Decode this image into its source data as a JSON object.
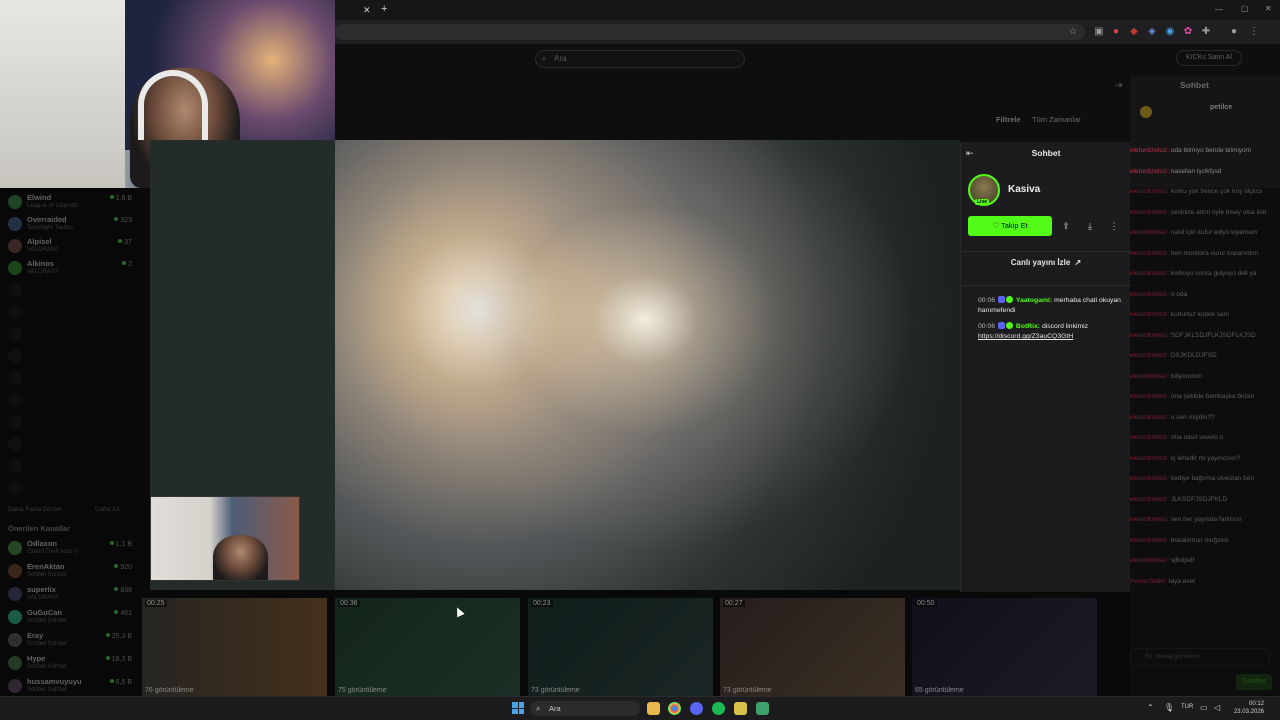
{
  "site": {
    "search_placeholder": "Ara",
    "filter_label": "Filtrele",
    "filter_value": "Tüm Zamanlar",
    "login_button": "KICKs Satın Al"
  },
  "sidebar": {
    "channels": [
      {
        "name": "Elwind",
        "game": "League of Legends",
        "viewers": "1,6 B"
      },
      {
        "name": "Overraided",
        "game": "Teamfight Tactics",
        "viewers": "323"
      },
      {
        "name": "Alpisel",
        "game": "VALORANT",
        "viewers": "37"
      },
      {
        "name": "Alkinos",
        "game": "VALORANT",
        "viewers": "2"
      }
    ],
    "show_more": "Daha Fazla Göster",
    "show_less": "Daha Az",
    "recommended_heading": "Önerilen Kanallar",
    "recommended": [
      {
        "name": "Odlaxon",
        "game": "Grand Theft Auto V",
        "viewers": "1,1 B"
      },
      {
        "name": "ErenAktan",
        "game": "Sohbet Sohbet",
        "viewers": "920"
      },
      {
        "name": "superlix",
        "game": "VALORANT",
        "viewers": "838"
      },
      {
        "name": "GuGuCan",
        "game": "Sohbet Sohbet",
        "viewers": "461"
      },
      {
        "name": "Eray",
        "game": "Sohbet Sohbet",
        "viewers": "25,3 B"
      },
      {
        "name": "Hype",
        "game": "Sohbet Sohbet",
        "viewers": "16,3 B"
      },
      {
        "name": "hussamvuyuyu",
        "game": "Sohbet Sohbet",
        "viewers": "6,5 B"
      }
    ]
  },
  "right_chat": {
    "title": "Sohbet",
    "lines": [
      {
        "user": "eletunitzelsiz:",
        "text": "oda bilmiyo bende bilmiyom"
      },
      {
        "user": "eletunitzelsiz:",
        "text": "nasellan işcikfşsd"
      },
      {
        "user": "eletunitzelsiz:",
        "text": "korku yok bence çok hoş ölçkcs"
      },
      {
        "user": "eletunitzelsiz:",
        "text": "sesinize aitrin oyle bisey olsa ileti"
      },
      {
        "user": "eletunitzelsiz:",
        "text": "nasil için kufur ediyo kiyamam"
      },
      {
        "user": "eletunitzelsiz:",
        "text": "ben monitora vurur koparırdım"
      },
      {
        "user": "eletunitzelsiz:",
        "text": "korkuyo sonra gulyuyo deli ya"
      },
      {
        "user": "eletunitzelsiz:",
        "text": "o oda"
      },
      {
        "user": "eletunitzelsiz:",
        "text": "kudurtuz kopek sanı"
      },
      {
        "user": "eletunitzelsiz:",
        "text": "SDFJKLSDJFLKJSDFLKJSD"
      },
      {
        "user": "eletunitzelsiz:",
        "text": "DSJKDLDJFSD"
      },
      {
        "user": "eletunitzelsiz:",
        "text": "biliyorumm"
      },
      {
        "user": "eletunitzelsiz:",
        "text": "ona şekilde bambaşka birisin"
      },
      {
        "user": "eletunitzelsiz:",
        "text": "o sen miydin??"
      },
      {
        "user": "eletunitzelsiz:",
        "text": "oha nasıl sevelo o"
      },
      {
        "user": "eletunitzelsiz:",
        "text": "iç lehedir mi yayıncısın?"
      },
      {
        "user": "eletunitzelsiz:",
        "text": "kediye bağırma ulvestan ben"
      },
      {
        "user": "eletunitzelsiz:",
        "text": "JLKSDFJSDJFKLD"
      },
      {
        "user": "eletunitzelsiz:",
        "text": "sen her yayında farklısın"
      },
      {
        "user": "eletunitzelsiz:",
        "text": "bokalemun muğzesi"
      },
      {
        "user": "eletunitzelsiz:",
        "text": "sjfkdjsdf"
      },
      {
        "user": "PeeterStalki:",
        "text": "taya evet"
      }
    ],
    "input_placeholder": "Bir mesaj gönderin",
    "send_button": "Gönder"
  },
  "thumbnails": [
    {
      "duration": "00:25",
      "views": "76 görüntüleme"
    },
    {
      "duration": "00:36",
      "views": "75 görüntüleme"
    },
    {
      "duration": "00:23",
      "views": "73 görüntüleme"
    },
    {
      "duration": "00:27",
      "views": "73 görüntüleme"
    },
    {
      "duration": "00:50",
      "views": "65 görüntüleme"
    }
  ],
  "modal_chat": {
    "title": "Sohbet",
    "streamer": "Kasiva",
    "live_badge": "Live",
    "follow_label": "Takip Et",
    "watch_live_label": "Canlı yayını İzle",
    "messages": [
      {
        "time": "00:06",
        "user": "Yaatogami:",
        "user_color": "#53fc18",
        "text": "merhaba chati okuyan hanımefendi"
      },
      {
        "time": "00:06",
        "user": "BotRix:",
        "user_color": "#53fc18",
        "text": "discord linkimiz",
        "link": "https://discord.gg/Z3auCQ3GtH"
      }
    ]
  },
  "taskbar": {
    "search": "Ara",
    "lang": "TUR",
    "time": "00:12",
    "date": "23.03.2026"
  },
  "colors": {
    "accent": "#53fc18",
    "chat_user": "#b5324a"
  }
}
